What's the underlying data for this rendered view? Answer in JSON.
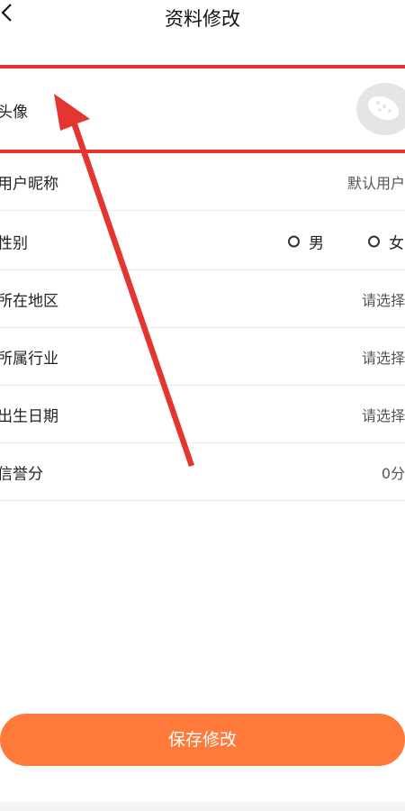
{
  "header": {
    "title": "资料修改",
    "back_icon": "chevron-left-icon"
  },
  "avatar_row": {
    "label": "头像",
    "avatar_icon": "default-avatar-icon",
    "highlight_color": "#e53530"
  },
  "rows": [
    {
      "label": "用户昵称",
      "value": "默认用户"
    },
    {
      "label": "性别",
      "options": [
        "男",
        "女"
      ]
    },
    {
      "label": "所在地区",
      "value": "请选择"
    },
    {
      "label": "所属行业",
      "value": "请选择"
    },
    {
      "label": "出生日期",
      "value": "请选择"
    },
    {
      "label": "信誉分",
      "value": "0分"
    }
  ],
  "save_button": {
    "label": "保存修改",
    "color": "#ff7a3a"
  },
  "annotation": {
    "arrow_color": "#e53530"
  }
}
